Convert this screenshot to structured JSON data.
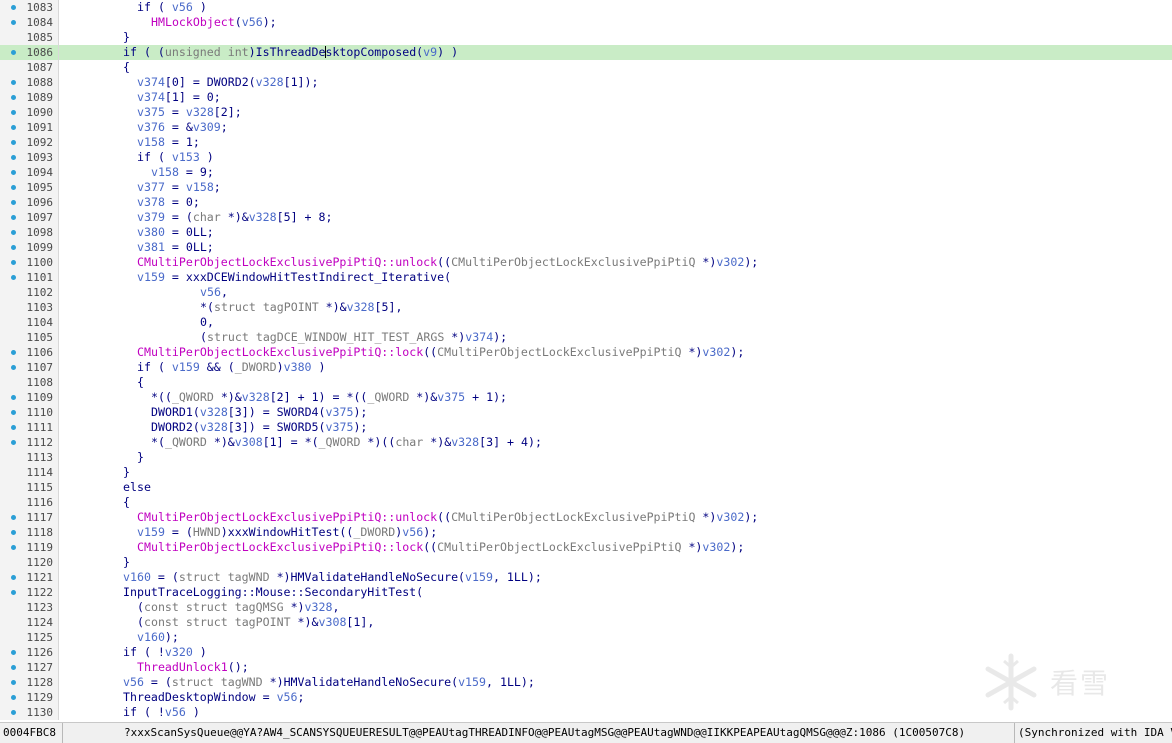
{
  "editor": {
    "highlighted_line": "1086",
    "lines": [
      {
        "num": "1083",
        "bp": true,
        "indent": 10,
        "tokens": [
          [
            "p",
            "if ( "
          ],
          [
            "v",
            "v56"
          ],
          [
            "p",
            " )"
          ]
        ]
      },
      {
        "num": "1084",
        "bp": true,
        "indent": 12,
        "tokens": [
          [
            "f",
            "HMLockObject"
          ],
          [
            "p",
            "("
          ],
          [
            "v",
            "v56"
          ],
          [
            "p",
            ");"
          ]
        ]
      },
      {
        "num": "1085",
        "bp": false,
        "indent": 8,
        "tokens": [
          [
            "p",
            "}"
          ]
        ]
      },
      {
        "num": "1086",
        "bp": true,
        "indent": 8,
        "tokens": [
          [
            "p",
            "if ( ("
          ],
          [
            "t",
            "unsigned int"
          ],
          [
            "p",
            ")IsThreadDe"
          ],
          [
            "caret",
            ""
          ],
          [
            "p",
            "sktopComposed("
          ],
          [
            "v",
            "v9"
          ],
          [
            "p",
            ") )"
          ]
        ]
      },
      {
        "num": "1087",
        "bp": false,
        "indent": 8,
        "tokens": [
          [
            "p",
            "{"
          ]
        ]
      },
      {
        "num": "1088",
        "bp": true,
        "indent": 10,
        "tokens": [
          [
            "v",
            "v374"
          ],
          [
            "p",
            "[0] = DWORD2("
          ],
          [
            "v",
            "v328"
          ],
          [
            "p",
            "[1]);"
          ]
        ]
      },
      {
        "num": "1089",
        "bp": true,
        "indent": 10,
        "tokens": [
          [
            "v",
            "v374"
          ],
          [
            "p",
            "[1] = 0;"
          ]
        ]
      },
      {
        "num": "1090",
        "bp": true,
        "indent": 10,
        "tokens": [
          [
            "v",
            "v375"
          ],
          [
            "p",
            " = "
          ],
          [
            "v",
            "v328"
          ],
          [
            "p",
            "[2];"
          ]
        ]
      },
      {
        "num": "1091",
        "bp": true,
        "indent": 10,
        "tokens": [
          [
            "v",
            "v376"
          ],
          [
            "p",
            " = &"
          ],
          [
            "v",
            "v309"
          ],
          [
            "p",
            ";"
          ]
        ]
      },
      {
        "num": "1092",
        "bp": true,
        "indent": 10,
        "tokens": [
          [
            "v",
            "v158"
          ],
          [
            "p",
            " = 1;"
          ]
        ]
      },
      {
        "num": "1093",
        "bp": true,
        "indent": 10,
        "tokens": [
          [
            "p",
            "if ( "
          ],
          [
            "v",
            "v153"
          ],
          [
            "p",
            " )"
          ]
        ]
      },
      {
        "num": "1094",
        "bp": true,
        "indent": 12,
        "tokens": [
          [
            "v",
            "v158"
          ],
          [
            "p",
            " = 9;"
          ]
        ]
      },
      {
        "num": "1095",
        "bp": true,
        "indent": 10,
        "tokens": [
          [
            "v",
            "v377"
          ],
          [
            "p",
            " = "
          ],
          [
            "v",
            "v158"
          ],
          [
            "p",
            ";"
          ]
        ]
      },
      {
        "num": "1096",
        "bp": true,
        "indent": 10,
        "tokens": [
          [
            "v",
            "v378"
          ],
          [
            "p",
            " = 0;"
          ]
        ]
      },
      {
        "num": "1097",
        "bp": true,
        "indent": 10,
        "tokens": [
          [
            "v",
            "v379"
          ],
          [
            "p",
            " = ("
          ],
          [
            "t",
            "char"
          ],
          [
            "p",
            " *)&"
          ],
          [
            "v",
            "v328"
          ],
          [
            "p",
            "[5] + 8;"
          ]
        ]
      },
      {
        "num": "1098",
        "bp": true,
        "indent": 10,
        "tokens": [
          [
            "v",
            "v380"
          ],
          [
            "p",
            " = 0LL;"
          ]
        ]
      },
      {
        "num": "1099",
        "bp": true,
        "indent": 10,
        "tokens": [
          [
            "v",
            "v381"
          ],
          [
            "p",
            " = 0LL;"
          ]
        ]
      },
      {
        "num": "1100",
        "bp": true,
        "indent": 10,
        "tokens": [
          [
            "f",
            "CMultiPerObjectLockExclusivePpiPtiQ::unlock"
          ],
          [
            "p",
            "(("
          ],
          [
            "t",
            "CMultiPerObjectLockExclusivePpiPtiQ"
          ],
          [
            "p",
            " *)"
          ],
          [
            "v",
            "v302"
          ],
          [
            "p",
            ");"
          ]
        ]
      },
      {
        "num": "1101",
        "bp": true,
        "indent": 10,
        "tokens": [
          [
            "v",
            "v159"
          ],
          [
            "p",
            " = xxxDCEWindowHitTestIndirect_Iterative("
          ]
        ]
      },
      {
        "num": "1102",
        "bp": false,
        "indent": 19,
        "tokens": [
          [
            "v",
            "v56"
          ],
          [
            "p",
            ","
          ]
        ]
      },
      {
        "num": "1103",
        "bp": false,
        "indent": 19,
        "tokens": [
          [
            "p",
            "*("
          ],
          [
            "t",
            "struct tagPOINT"
          ],
          [
            "p",
            " *)&"
          ],
          [
            "v",
            "v328"
          ],
          [
            "p",
            "[5],"
          ]
        ]
      },
      {
        "num": "1104",
        "bp": false,
        "indent": 19,
        "tokens": [
          [
            "p",
            "0,"
          ]
        ]
      },
      {
        "num": "1105",
        "bp": false,
        "indent": 19,
        "tokens": [
          [
            "p",
            "("
          ],
          [
            "t",
            "struct tagDCE_WINDOW_HIT_TEST_ARGS"
          ],
          [
            "p",
            " *)"
          ],
          [
            "v",
            "v374"
          ],
          [
            "p",
            ");"
          ]
        ]
      },
      {
        "num": "1106",
        "bp": true,
        "indent": 10,
        "tokens": [
          [
            "f",
            "CMultiPerObjectLockExclusivePpiPtiQ::lock"
          ],
          [
            "p",
            "(("
          ],
          [
            "t",
            "CMultiPerObjectLockExclusivePpiPtiQ"
          ],
          [
            "p",
            " *)"
          ],
          [
            "v",
            "v302"
          ],
          [
            "p",
            ");"
          ]
        ]
      },
      {
        "num": "1107",
        "bp": true,
        "indent": 10,
        "tokens": [
          [
            "p",
            "if ( "
          ],
          [
            "v",
            "v159"
          ],
          [
            "p",
            " && ("
          ],
          [
            "t",
            "_DWORD"
          ],
          [
            "p",
            ")"
          ],
          [
            "v",
            "v380"
          ],
          [
            "p",
            " )"
          ]
        ]
      },
      {
        "num": "1108",
        "bp": false,
        "indent": 10,
        "tokens": [
          [
            "p",
            "{"
          ]
        ]
      },
      {
        "num": "1109",
        "bp": true,
        "indent": 12,
        "tokens": [
          [
            "p",
            "*(("
          ],
          [
            "t",
            "_QWORD"
          ],
          [
            "p",
            " *)&"
          ],
          [
            "v",
            "v328"
          ],
          [
            "p",
            "[2] + 1) = *(("
          ],
          [
            "t",
            "_QWORD"
          ],
          [
            "p",
            " *)&"
          ],
          [
            "v",
            "v375"
          ],
          [
            "p",
            " + 1);"
          ]
        ]
      },
      {
        "num": "1110",
        "bp": true,
        "indent": 12,
        "tokens": [
          [
            "p",
            "DWORD1("
          ],
          [
            "v",
            "v328"
          ],
          [
            "p",
            "[3]) = SWORD4("
          ],
          [
            "v",
            "v375"
          ],
          [
            "p",
            ");"
          ]
        ]
      },
      {
        "num": "1111",
        "bp": true,
        "indent": 12,
        "tokens": [
          [
            "p",
            "DWORD2("
          ],
          [
            "v",
            "v328"
          ],
          [
            "p",
            "[3]) = SWORD5("
          ],
          [
            "v",
            "v375"
          ],
          [
            "p",
            ");"
          ]
        ]
      },
      {
        "num": "1112",
        "bp": true,
        "indent": 12,
        "tokens": [
          [
            "p",
            "*("
          ],
          [
            "t",
            "_QWORD"
          ],
          [
            "p",
            " *)&"
          ],
          [
            "v",
            "v308"
          ],
          [
            "p",
            "[1] = *("
          ],
          [
            "t",
            "_QWORD"
          ],
          [
            "p",
            " *)(("
          ],
          [
            "t",
            "char"
          ],
          [
            "p",
            " *)&"
          ],
          [
            "v",
            "v328"
          ],
          [
            "p",
            "[3] + 4);"
          ]
        ]
      },
      {
        "num": "1113",
        "bp": false,
        "indent": 10,
        "tokens": [
          [
            "p",
            "}"
          ]
        ]
      },
      {
        "num": "1114",
        "bp": false,
        "indent": 8,
        "tokens": [
          [
            "p",
            "}"
          ]
        ]
      },
      {
        "num": "1115",
        "bp": false,
        "indent": 8,
        "tokens": [
          [
            "p",
            "else"
          ]
        ]
      },
      {
        "num": "1116",
        "bp": false,
        "indent": 8,
        "tokens": [
          [
            "p",
            "{"
          ]
        ]
      },
      {
        "num": "1117",
        "bp": true,
        "indent": 10,
        "tokens": [
          [
            "f",
            "CMultiPerObjectLockExclusivePpiPtiQ::unlock"
          ],
          [
            "p",
            "(("
          ],
          [
            "t",
            "CMultiPerObjectLockExclusivePpiPtiQ"
          ],
          [
            "p",
            " *)"
          ],
          [
            "v",
            "v302"
          ],
          [
            "p",
            ");"
          ]
        ]
      },
      {
        "num": "1118",
        "bp": true,
        "indent": 10,
        "tokens": [
          [
            "v",
            "v159"
          ],
          [
            "p",
            " = ("
          ],
          [
            "t",
            "HWND"
          ],
          [
            "p",
            ")xxxWindowHitTest(("
          ],
          [
            "t",
            "_DWORD"
          ],
          [
            "p",
            ")"
          ],
          [
            "v",
            "v56"
          ],
          [
            "p",
            ");"
          ]
        ]
      },
      {
        "num": "1119",
        "bp": true,
        "indent": 10,
        "tokens": [
          [
            "f",
            "CMultiPerObjectLockExclusivePpiPtiQ::lock"
          ],
          [
            "p",
            "(("
          ],
          [
            "t",
            "CMultiPerObjectLockExclusivePpiPtiQ"
          ],
          [
            "p",
            " *)"
          ],
          [
            "v",
            "v302"
          ],
          [
            "p",
            ");"
          ]
        ]
      },
      {
        "num": "1120",
        "bp": false,
        "indent": 8,
        "tokens": [
          [
            "p",
            "}"
          ]
        ]
      },
      {
        "num": "1121",
        "bp": true,
        "indent": 8,
        "tokens": [
          [
            "v",
            "v160"
          ],
          [
            "p",
            " = ("
          ],
          [
            "t",
            "struct tagWND"
          ],
          [
            "p",
            " *)HMValidateHandleNoSecure("
          ],
          [
            "v",
            "v159"
          ],
          [
            "p",
            ", 1LL);"
          ]
        ]
      },
      {
        "num": "1122",
        "bp": true,
        "indent": 8,
        "tokens": [
          [
            "p",
            "InputTraceLogging::Mouse::SecondaryHitTest("
          ]
        ]
      },
      {
        "num": "1123",
        "bp": false,
        "indent": 10,
        "tokens": [
          [
            "p",
            "("
          ],
          [
            "t",
            "const struct tagQMSG"
          ],
          [
            "p",
            " *)"
          ],
          [
            "v",
            "v328"
          ],
          [
            "p",
            ","
          ]
        ]
      },
      {
        "num": "1124",
        "bp": false,
        "indent": 10,
        "tokens": [
          [
            "p",
            "("
          ],
          [
            "t",
            "const struct tagPOINT"
          ],
          [
            "p",
            " *)&"
          ],
          [
            "v",
            "v308"
          ],
          [
            "p",
            "[1],"
          ]
        ]
      },
      {
        "num": "1125",
        "bp": false,
        "indent": 10,
        "tokens": [
          [
            "v",
            "v160"
          ],
          [
            "p",
            ");"
          ]
        ]
      },
      {
        "num": "1126",
        "bp": true,
        "indent": 8,
        "tokens": [
          [
            "p",
            "if ( !"
          ],
          [
            "v",
            "v320"
          ],
          [
            "p",
            " )"
          ]
        ]
      },
      {
        "num": "1127",
        "bp": true,
        "indent": 10,
        "tokens": [
          [
            "f",
            "ThreadUnlock1"
          ],
          [
            "p",
            "();"
          ]
        ]
      },
      {
        "num": "1128",
        "bp": true,
        "indent": 8,
        "tokens": [
          [
            "v",
            "v56"
          ],
          [
            "p",
            " = ("
          ],
          [
            "t",
            "struct tagWND"
          ],
          [
            "p",
            " *)HMValidateHandleNoSecure("
          ],
          [
            "v",
            "v159"
          ],
          [
            "p",
            ", 1LL);"
          ]
        ]
      },
      {
        "num": "1129",
        "bp": true,
        "indent": 8,
        "tokens": [
          [
            "p",
            "ThreadDesktopWindow = "
          ],
          [
            "v",
            "v56"
          ],
          [
            "p",
            ";"
          ]
        ]
      },
      {
        "num": "1130",
        "bp": true,
        "indent": 8,
        "tokens": [
          [
            "p",
            "if ( !"
          ],
          [
            "v",
            "v56"
          ],
          [
            "p",
            " )"
          ]
        ]
      }
    ]
  },
  "status_bar": {
    "address": "0004FBC8",
    "location": "?xxxScanSysQueue@@YA?AW4_SCANSYSQUEUERESULT@@PEAUtagTHREADINFO@@PEAUtagMSG@@PEAUtagWND@@IIKKPEAPEAUtagQMSG@@@Z:1086 (1C00507C8)",
    "sync": "(Synchronized with IDA View-A)"
  },
  "watermark": {
    "text": "看雪",
    "icon": "snowflake-logo-icon"
  },
  "colors": {
    "plain": "#000080",
    "variable": "#4a6ac9",
    "function": "#c000c0",
    "type": "#7a7a7a",
    "highlight": "#c9ecc6",
    "breakpoint": "#2b9fd6"
  }
}
